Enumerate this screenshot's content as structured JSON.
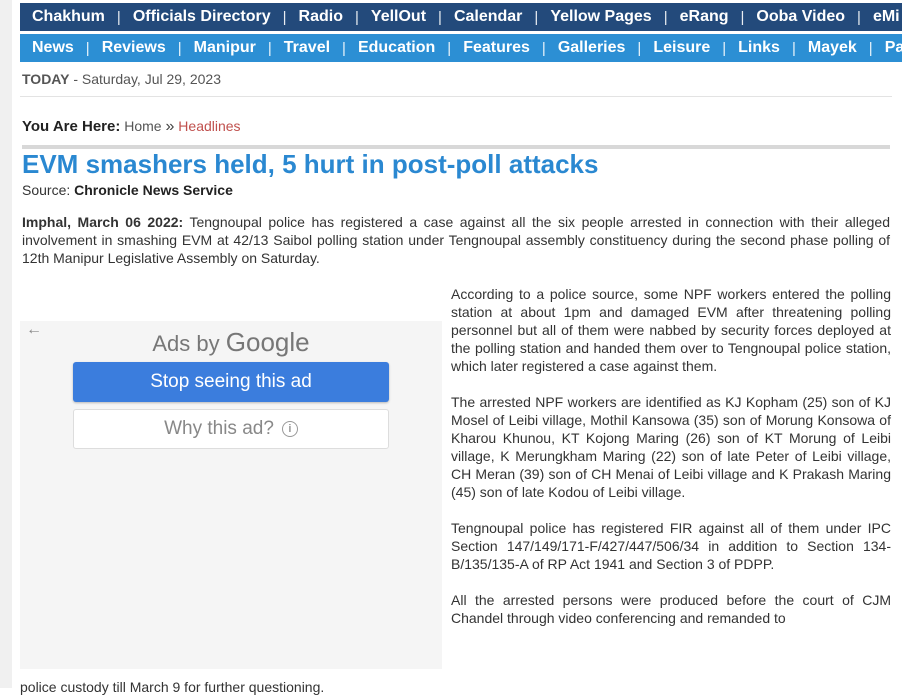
{
  "nav_primary": [
    "Chakhum",
    "Officials Directory",
    "Radio",
    "YellOut",
    "Calendar",
    "Yellow Pages",
    "eRang",
    "Ooba Video",
    "eMi"
  ],
  "nav_secondary": [
    "News",
    "Reviews",
    "Manipur",
    "Travel",
    "Education",
    "Features",
    "Galleries",
    "Leisure",
    "Links",
    "Mayek",
    "Panor"
  ],
  "today": {
    "label": "TODAY",
    "date": "Saturday, Jul 29, 2023"
  },
  "breadcrumb": {
    "label": "You Are Here:",
    "home": "Home",
    "sep": "»",
    "current": "Headlines"
  },
  "article": {
    "title": "EVM smashers held, 5 hurt in post-poll attacks",
    "source_label": "Source:",
    "source": "Chronicle News Service",
    "dateline": "Imphal, March 06 2022:",
    "lead": "Tengnoupal police has registered a case against all the six people arrested in connection with their alleged involvement in smashing EVM at 42/13 Saibol polling station under Tengnoupal assembly constituency during the second phase polling of 12th Manipur Legislative Assembly on Saturday.",
    "paragraphs": [
      "According to a police source, some NPF workers entered the polling station at about 1pm and damaged EVM after threatening polling personnel but all of them were nabbed by security forces deployed at the polling station and handed them over to Tengnoupal police station, which later registered a case against them.",
      "The arrested NPF workers are identified as KJ Kopham (25) son of KJ Mosel of Leibi village, Mothil Kansowa (35) son of Morung Konsowa of Kharou Khunou, KT Kojong Maring (26) son of KT Morung of Leibi village, K Merungkham Maring (22) son of late Peter of Leibi village, CH Meran (39) son of CH Menai of Leibi village and K Prakash Maring (45) son of late Kodou of Leibi village.",
      "Tengnoupal police has registered FIR against all of them under IPC Section 147/149/171-F/427/447/506/34 in addition to Section 134-B/135/135-A of RP Act 1941 and Section 3 of PDPP.",
      "All the arrested persons were produced before the court of CJM Chandel through video conferencing and remanded to"
    ],
    "tail": "police custody till March 9 for further questioning."
  },
  "ad": {
    "back_icon": "←",
    "ads_by": "Ads by",
    "google": "Google",
    "stop_label": "Stop seeing this ad",
    "why_label": "Why this ad?",
    "info_glyph": "i"
  },
  "colors": {
    "nav_primary_bg": "#234a7b",
    "nav_secondary_bg": "#2c8fd4",
    "headline": "#2a88d1",
    "crumb_current": "#c0504d"
  }
}
